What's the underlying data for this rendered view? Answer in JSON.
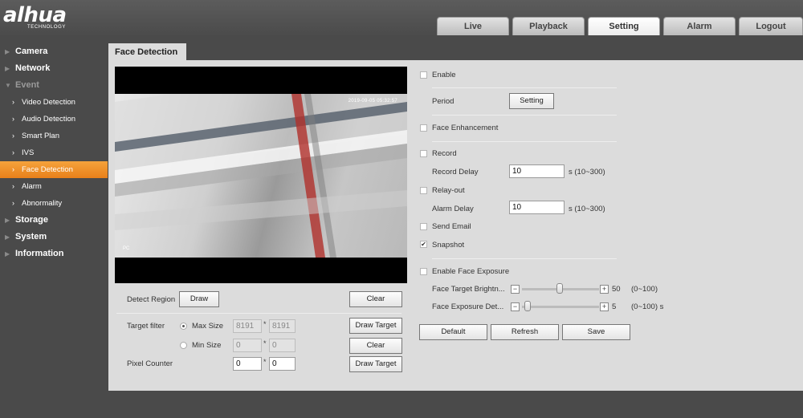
{
  "header": {
    "logo": "alhua",
    "logo_sub": "TECHNOLOGY",
    "tabs": [
      {
        "label": "Live"
      },
      {
        "label": "Playback"
      },
      {
        "label": "Setting",
        "active": true
      },
      {
        "label": "Alarm"
      },
      {
        "label": "Logout"
      }
    ]
  },
  "sidebar": {
    "items": [
      {
        "label": "Camera"
      },
      {
        "label": "Network"
      },
      {
        "label": "Event",
        "expanded": true
      },
      {
        "label": "Video Detection"
      },
      {
        "label": "Audio Detection"
      },
      {
        "label": "Smart Plan"
      },
      {
        "label": "IVS"
      },
      {
        "label": "Face Detection",
        "active": true
      },
      {
        "label": "Alarm"
      },
      {
        "label": "Abnormality"
      },
      {
        "label": "Storage"
      },
      {
        "label": "System"
      },
      {
        "label": "Information"
      }
    ]
  },
  "panel": {
    "tab_label": "Face Detection",
    "video": {
      "timestamp": "2019-09-05 05:32:57",
      "osd_label": "PC"
    },
    "left_form": {
      "detect_region_label": "Detect Region",
      "draw_button": "Draw",
      "clear_button": "Clear",
      "target_filter_label": "Target filter",
      "max_size_label": "Max Size",
      "max_w": "8191",
      "max_h": "8191",
      "draw_target_button": "Draw Target",
      "min_size_label": "Min Size",
      "min_w": "0",
      "min_h": "0",
      "clear_button_2": "Clear",
      "pixel_counter_label": "Pixel Counter",
      "pixel_w": "0",
      "pixel_h": "0",
      "draw_target_button_2": "Draw Target",
      "times": "*"
    },
    "right_form": {
      "enable_label": "Enable",
      "period_label": "Period",
      "period_setting_button": "Setting",
      "face_enhancement_label": "Face Enhancement",
      "record_label": "Record",
      "record_delay_label": "Record Delay",
      "record_delay_value": "10",
      "record_delay_range": "s (10~300)",
      "relay_out_label": "Relay-out",
      "alarm_delay_label": "Alarm Delay",
      "alarm_delay_value": "10",
      "alarm_delay_range": "s (10~300)",
      "send_email_label": "Send Email",
      "snapshot_label": "Snapshot",
      "snapshot_checked": true,
      "enable_face_exposure_label": "Enable Face Exposure",
      "face_target_brightness_label": "Face Target Brightn...",
      "face_target_brightness_value": "50",
      "face_target_brightness_range": "(0~100)",
      "face_exposure_detect_label": "Face Exposure Det...",
      "face_exposure_detect_value": "5",
      "face_exposure_detect_range": "(0~100) s",
      "default_button": "Default",
      "refresh_button": "Refresh",
      "save_button": "Save",
      "check_mark": "✔",
      "minus": "−",
      "plus": "+"
    }
  }
}
